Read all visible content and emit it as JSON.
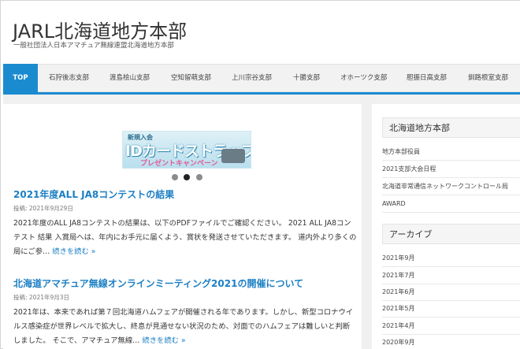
{
  "site": {
    "title": "JARL北海道地方本部",
    "tagline": "一般社団法人日本アマチュア無線連盟北海道地方本部"
  },
  "nav": {
    "items": [
      "TOP",
      "石狩後志支部",
      "渡島桧山支部",
      "空知留萌支部",
      "上川宗谷支部",
      "十勝支部",
      "オホーツク支部",
      "胆振日高支部",
      "釧路根室支部"
    ]
  },
  "slider": {
    "banner_small": "新規入会",
    "banner_big": "IDカードストラップ",
    "banner_sub": "プレゼントキャンペーン",
    "slide_count": 3,
    "active_slide": 2
  },
  "posts": [
    {
      "title": "2021年度ALL JA8コンテストの結果",
      "date": "投稿: 2021年9月29日",
      "body": "2021年度のALL JA8コンテストの結果は、以下のPDFファイルでご確認ください。 2021 ALL JA8コンテスト 結果 入賞局へは、年内にお手元に届くよう、賞状を発送させていただきます。 道内外より多くの局にご参…",
      "more": "続きを読む »"
    },
    {
      "title": "北海道アマチュア無線オンラインミーティング2021の開催について",
      "date": "投稿: 2021年9月3日",
      "body": "2021年は、本来であれば第７回北海道ハムフェアが開催される年であります。しかし、新型コロナウイルス感染症が世界レベルで拡大し、終息が見通せない状況のため、対面でのハムフェアは難しいと判断しました。 そこで、アマチュア無線…",
      "more": "続きを読む »"
    }
  ],
  "sidebar": {
    "widget1_title": "北海道地方本部",
    "widget1_items": [
      "地方本部役員",
      "2021支部大会日程",
      "北海道非常通信ネットワークコントロール局",
      "AWARD"
    ],
    "widget2_title": "アーカイブ",
    "widget2_items": [
      "2021年9月",
      "2021年7月",
      "2021年6月",
      "2021年5月",
      "2021年4月",
      "2020年9月"
    ]
  },
  "colors": {
    "accent": "#1b8bd0",
    "link": "#1b7fc4"
  }
}
